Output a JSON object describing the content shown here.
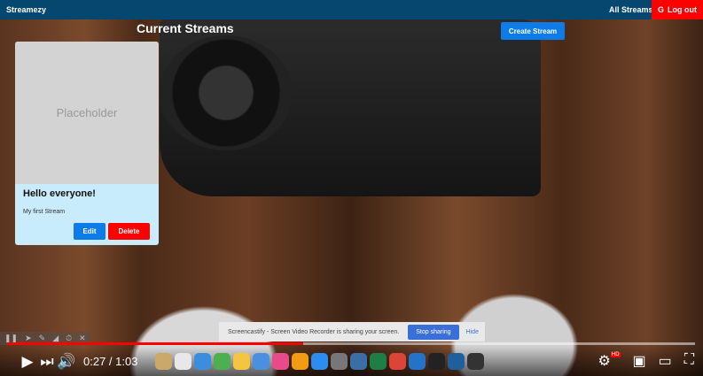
{
  "navbar": {
    "brand": "Streamezy",
    "all_streams": "All Streams",
    "logout": "Log out",
    "logout_icon": "G"
  },
  "page": {
    "title": "Current Streams",
    "create_button": "Create Stream"
  },
  "streams": [
    {
      "image_placeholder": "Placeholder",
      "title": "Hello everyone!",
      "description": "My first Stream",
      "edit": "Edit",
      "delete": "Delete"
    }
  ],
  "share_bar": {
    "message": "Screencastify - Screen Video Recorder is sharing your screen.",
    "stop": "Stop sharing",
    "hide": "Hide"
  },
  "player": {
    "time": "0:27 / 1:03",
    "progress_fraction": 0.43,
    "quality_badge": "HD"
  },
  "colors": {
    "navbar": "#05476f",
    "primary": "#0e7ce8",
    "danger": "#ff0000",
    "card": "#c8ecfb"
  }
}
